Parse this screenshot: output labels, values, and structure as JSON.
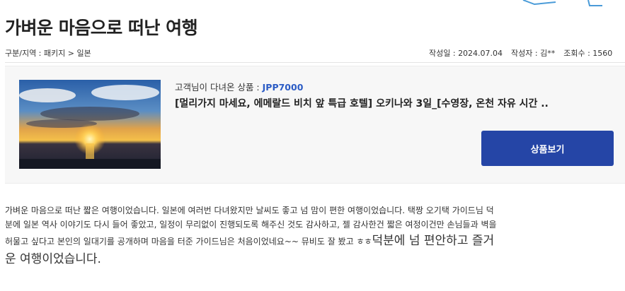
{
  "post": {
    "title": "가벼운 마음으로 떠난 여행",
    "category_label": "구분/지역 : ",
    "category_path": [
      "패키지",
      "일본"
    ],
    "category_separator": ">",
    "date_label": "작성일 : ",
    "date": "2024.07.04",
    "author_label": "작성자 : ",
    "author": "김**",
    "views_label": "조회수 : ",
    "views": "1560"
  },
  "product": {
    "customer_label": "고객님이 다녀온 상품 :",
    "code": "JPP7000",
    "name": "[멀리가지 마세요, 에메랄드 비치 앞 특급 호텔] 오키나와 3일_[수영장, 온천 자유 시간 ..",
    "view_button": "상품보기",
    "image_caption": "sunset-over-sea"
  },
  "review": {
    "line1": "가벼운 마음으로 떠난 짧은 여행이었습니다. 일본에 여러번 다녀왔지만 날씨도 좋고 넘 맘이 편한 여행이었습니다. 택짱 오기택 가이드님 덕",
    "line2": "분에 일본 역사 이야기도 다시 들어 좋았고, 일정이 무리없이 진행되도록 해주신 것도 감사하고, 젤 감사한건 짧은 여정이건만 손님들과 벽을",
    "line3_small": "허물고 싶다고 본인의 일대기를 공개하며 마음을 터준 가이드님은 처음이었네요~~ 뮤비도 잘 봤고 ㅎㅎ",
    "line3_big": "덕분에 넘 편안하고 즐거",
    "line4_big": "운 여행이었습니다."
  },
  "colors": {
    "accent": "#2545a6",
    "code": "#2c5cc5",
    "box_bg": "#f7f7f7"
  }
}
